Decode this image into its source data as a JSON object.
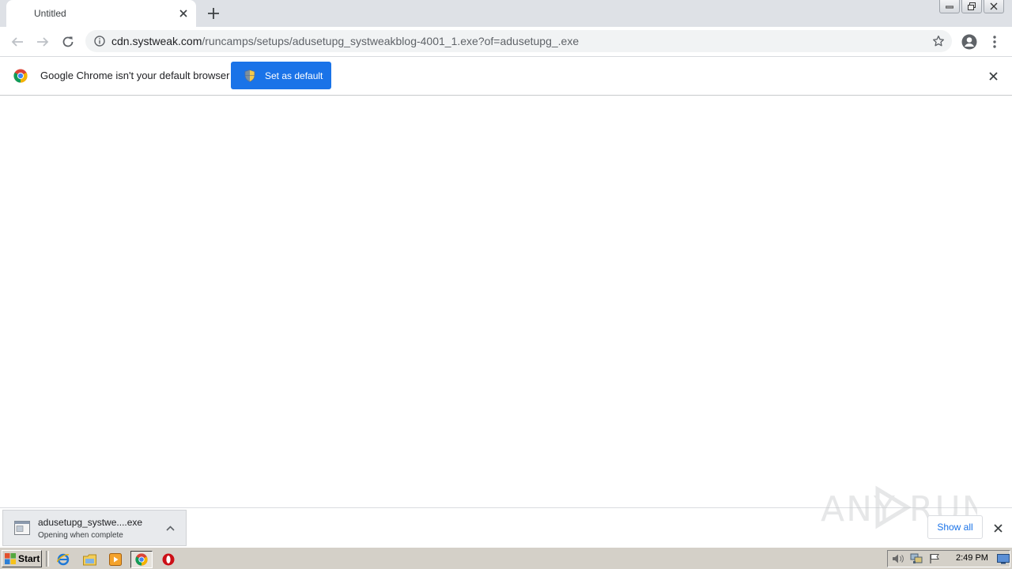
{
  "browser": {
    "tab": {
      "title": "Untitled"
    },
    "url": {
      "host": "cdn.systweak.com",
      "path": "/runcamps/setups/adusetupg_systweakblog-4001_1.exe?of=adusetupg_.exe"
    },
    "infobar": {
      "message": "Google Chrome isn't your default browser",
      "button_label": "Set as default"
    },
    "download": {
      "filename": "adusetupg_systwe....exe",
      "status": "Opening when complete",
      "show_all_label": "Show all"
    },
    "accent_color": "#1a73e8"
  },
  "taskbar": {
    "start_label": "Start",
    "quick_launch": [
      "internet-explorer-icon",
      "folder-icon",
      "media-player-icon",
      "chrome-icon",
      "opera-icon"
    ],
    "clock": "2:49 PM"
  },
  "watermark": {
    "text": "ANY RUN"
  }
}
